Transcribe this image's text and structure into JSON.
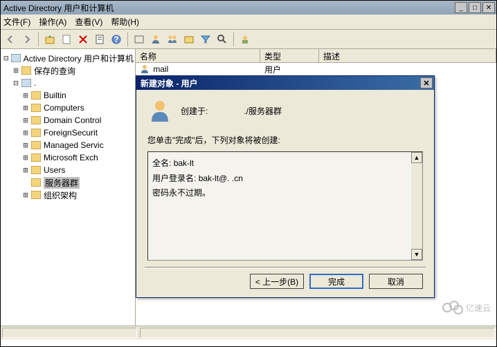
{
  "window": {
    "title": "Active Directory 用户和计算机"
  },
  "menubar": {
    "file": "文件(F)",
    "action": "操作(A)",
    "view": "查看(V)",
    "help": "帮助(H)"
  },
  "tree": {
    "root": "Active Directory 用户和计算机",
    "saved_queries": "保存的查询",
    "domain": ".",
    "items": [
      "Builtin",
      "Computers",
      "Domain Control",
      "ForeignSecurit",
      "Managed Servic",
      "Microsoft Exch",
      "Users",
      "服务器群",
      "组织架构"
    ]
  },
  "list": {
    "headers": {
      "name": "名称",
      "type": "类型",
      "desc": "描述"
    },
    "rows": [
      {
        "name": "mail",
        "type": "用户"
      }
    ]
  },
  "dialog": {
    "title": "新建对象 - 用户",
    "created_in_label": "创建于:",
    "created_in_value": "./服务器群",
    "prompt": "您单击\"完成\"后，下列对象将被创建:",
    "summary_fullname_label": "全名:",
    "summary_fullname_value": "bak-lt",
    "summary_logon_label": "用户登录名:",
    "summary_logon_value": "bak-lt@.   .cn",
    "summary_pwd": "密码永不过期。",
    "buttons": {
      "back": "< 上一步(B)",
      "finish": "完成",
      "cancel": "取消"
    }
  },
  "watermark": "亿速云"
}
